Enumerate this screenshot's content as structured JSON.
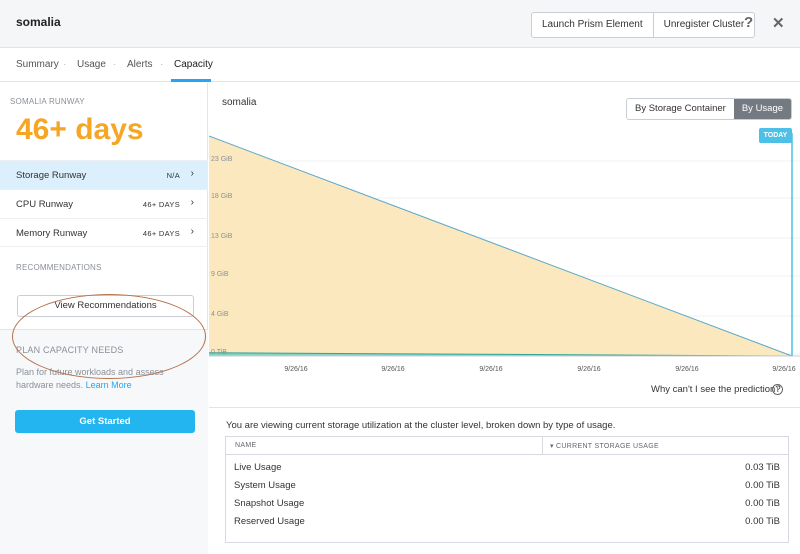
{
  "header": {
    "title": "somalia",
    "launch_label": "Launch Prism Element",
    "unregister_label": "Unregister Cluster",
    "help_glyph": "?",
    "close_glyph": "✕"
  },
  "tabs": [
    {
      "label": "Summary"
    },
    {
      "label": "Usage"
    },
    {
      "label": "Alerts"
    },
    {
      "label": "Capacity"
    }
  ],
  "tab_separator": "·",
  "sidebar": {
    "runway_label": "SOMALIA RUNWAY",
    "days": "46+ days",
    "rows": [
      {
        "label": "Storage Runway",
        "value": "N/A"
      },
      {
        "label": "CPU Runway",
        "value": "46+ DAYS"
      },
      {
        "label": "Memory Runway",
        "value": "46+ DAYS"
      }
    ],
    "chevron": "›",
    "recommendations_label": "RECOMMENDATIONS",
    "view_recommendations": "View Recommendations",
    "plan_title": "PLAN CAPACITY NEEDS",
    "plan_text": "Plan for future workloads and assess hardware needs.",
    "learn_more": "Learn More",
    "get_started": "Get Started"
  },
  "main": {
    "chart_title": "somalia",
    "toggle_container": "By Storage Container",
    "toggle_usage": "By Usage",
    "today": "TODAY",
    "prediction_question": "Why can't I see the prediction?",
    "info_glyph": "i",
    "info_line": "You are viewing current storage utilization at the cluster level, broken down by type of usage.",
    "table": {
      "col_name": "NAME",
      "col_usage": "▾ CURRENT STORAGE USAGE",
      "rows": [
        {
          "name": "Live Usage",
          "value": "0.03 TiB"
        },
        {
          "name": "System Usage",
          "value": "0.00 TiB"
        },
        {
          "name": "Snapshot Usage",
          "value": "0.00 TiB"
        },
        {
          "name": "Reserved Usage",
          "value": "0.00 TiB"
        }
      ]
    }
  },
  "chart_data": {
    "type": "area",
    "y_ticks": [
      "23 GiB",
      "18 GiB",
      "13 GiB",
      "9 GiB",
      "4 GiB",
      "0 TiB"
    ],
    "x_ticks": [
      "9/26/16",
      "9/26/16",
      "9/26/16",
      "9/26/16",
      "9/26/16",
      "9/26/16"
    ],
    "series": [
      {
        "values": [
          27,
          0
        ],
        "color": "#fbe5b8",
        "line": "#5aa9c9"
      },
      {
        "values": [
          0.4,
          0
        ],
        "color": "#7fd0c4",
        "line": "#2fa596"
      }
    ],
    "colors": {
      "accent": "#22a5f7",
      "orange": "#f5a623",
      "today": "#4cc0e6"
    }
  }
}
